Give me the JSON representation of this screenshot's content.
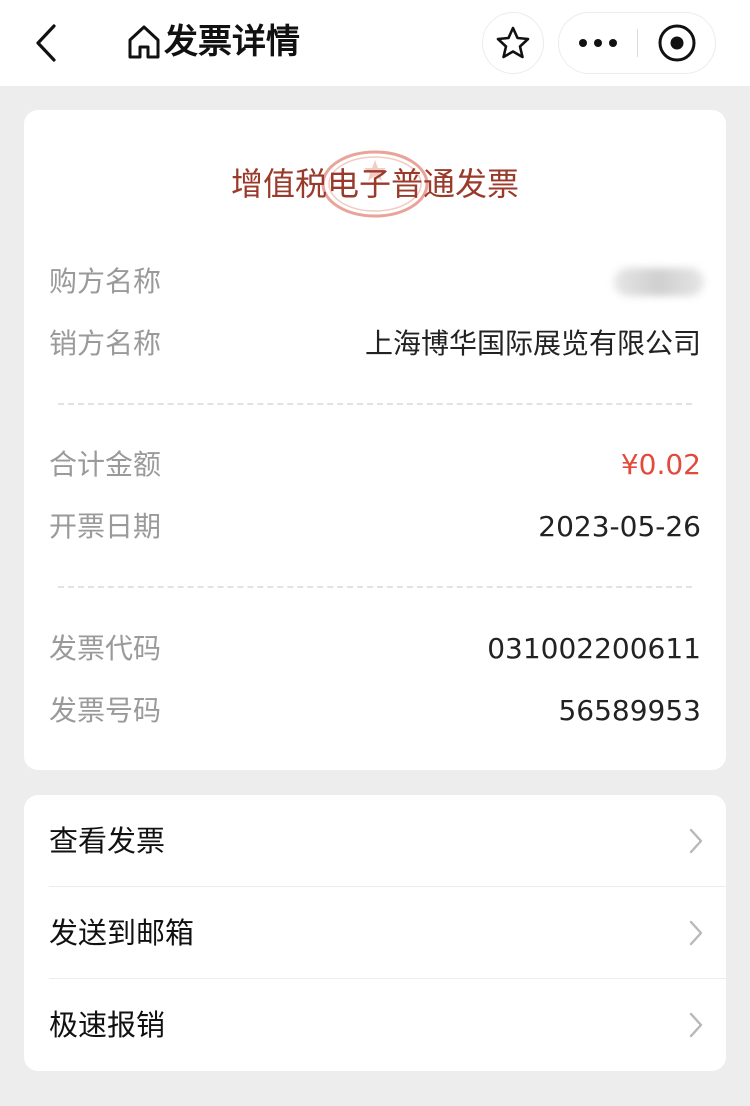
{
  "nav": {
    "title": "发票详情",
    "icons": {
      "back": "chevron-left-icon",
      "home": "home-icon",
      "star": "star-icon",
      "more": "more-dots-icon",
      "close": "target-circle-icon"
    }
  },
  "invoice": {
    "title": "增值税电子普通发票",
    "buyer_label": "购方名称",
    "seller_label": "销方名称",
    "seller_value": "上海博华国际展览有限公司",
    "amount_label": "合计金额",
    "amount_value": "¥0.02",
    "date_label": "开票日期",
    "date_value": "2023-05-26",
    "code_label": "发票代码",
    "code_value": "031002200611",
    "number_label": "发票号码",
    "number_value": "56589953"
  },
  "actions": {
    "items": [
      {
        "label": "查看发票"
      },
      {
        "label": "发送到邮箱"
      },
      {
        "label": "极速报销"
      }
    ]
  },
  "colors": {
    "title": "#9a3a2a",
    "seal": "#e9a49a",
    "amount": "#e14a3c",
    "label": "#9a9a9a",
    "background": "#ededed"
  }
}
